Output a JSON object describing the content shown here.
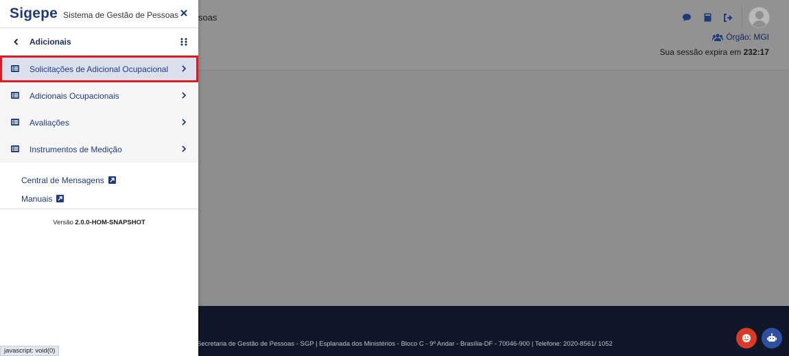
{
  "app": {
    "brand": "Sigepe",
    "brand_subtitle": "Sistema de Gestão de Pessoas",
    "background_title_fragment": "soas"
  },
  "header": {
    "orgao_label": "Órgão: MGI",
    "session_prefix": "Sua sessão expira em",
    "session_time": "232:17",
    "icons": [
      "chat-icon",
      "book-icon",
      "logout-icon",
      "user-avatar"
    ]
  },
  "sidebar": {
    "section_title": "Adicionais",
    "items": [
      {
        "label": "Solicitações de Adicional Ocupacional",
        "active": true
      },
      {
        "label": "Adicionais Ocupacionais",
        "active": false
      },
      {
        "label": "Avaliações",
        "active": false
      },
      {
        "label": "Instrumentos de Medição",
        "active": false
      }
    ],
    "links": [
      {
        "label": "Central de Mensagens"
      },
      {
        "label": "Manuais"
      }
    ],
    "version_prefix": "Versão",
    "version_value": "2.0.0-HOM-SNAPSHOT"
  },
  "footer": {
    "text": "Secretaria de Gestão de Pessoas - SGP | Esplanada dos Ministérios - Bloco C - 9º Andar - Brasília-DF - 70046-900 | Telefone: 2020-8561/ 1052"
  },
  "status_bar": {
    "text": "javascript: void(0)"
  },
  "colors": {
    "brand": "#1e3a7d",
    "active_highlight": "#e0191f",
    "footer_bg": "#101728",
    "feedback_button": "#d93a27",
    "bot_button": "#2f4fa0"
  }
}
